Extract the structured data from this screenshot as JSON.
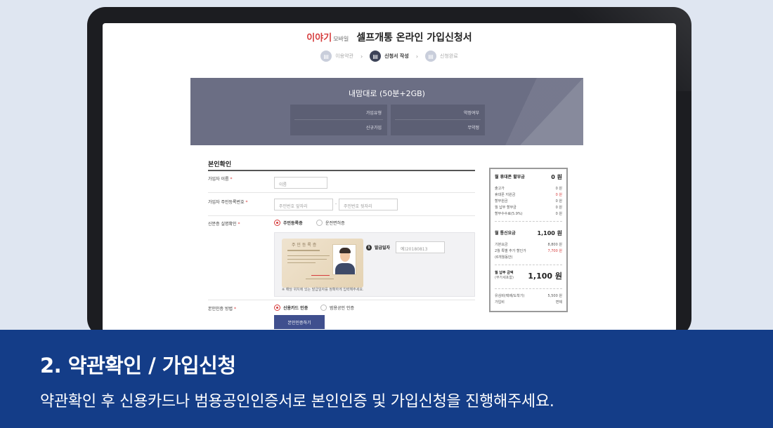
{
  "header": {
    "brand": "이야기",
    "brand_sub": "모바일",
    "title": "셀프개통 온라인 가입신청서"
  },
  "steps": [
    {
      "label": "이용약관"
    },
    {
      "label": "신청서 작성"
    },
    {
      "label": "신청완료"
    }
  ],
  "plan": {
    "name": "내맘대로 (50분+2GB)",
    "box1": {
      "row1": "가입유형",
      "row2": "신규가입"
    },
    "box2": {
      "row1": "약정여부",
      "row2": "무약정"
    }
  },
  "form": {
    "section_title": "본인확인",
    "name_label": "가입자 이름",
    "name_placeholder": "이름",
    "rrn_label": "가입자 주민등록번호",
    "rrn_front_placeholder": "주민번호 앞자리",
    "rrn_back_placeholder": "주민번호 뒷자리",
    "rrn_dash": "-",
    "idcheck_label": "신분증 실명확인",
    "idcheck_opt1": "주민등록증",
    "idcheck_opt2": "운전면허증",
    "req_mark": "*",
    "issue_num": "1",
    "issue_label": "발급일자",
    "issue_placeholder": "예)20180813",
    "id_note": "※ 해당 위치에 있는 발급일자를 정확하게 입력해주세요.",
    "idcard_title": "주 민 등 록 증",
    "auth_label": "본인인증 방법",
    "auth_opt1": "신용카드 인증",
    "auth_opt2": "범용공인 인증",
    "auth_button": "본인인증하기"
  },
  "summary": {
    "device_label": "월 휴대폰 할부금",
    "device_value": "0 원",
    "device_items": [
      {
        "label": "출고가",
        "value": "0 원"
      },
      {
        "label": "휴대폰 지원금",
        "value": "0 원"
      },
      {
        "label": "할부원금",
        "value": "0 원"
      },
      {
        "label": "월 납부 할부금",
        "value": "0 원"
      },
      {
        "label": "할부수수료(5.9%)",
        "value": "0 원"
      }
    ],
    "plan_label": "월 통신요금",
    "plan_value": "1,100 원",
    "plan_items": [
      {
        "label": "기본요금",
        "value": "8,800 원"
      },
      {
        "label": "2월 특별 추가 할인가",
        "value": "7,700 원"
      },
      {
        "label": "(6개월동안)",
        "value": ""
      }
    ],
    "total_label": "월 납부 금액",
    "total_sub": "(부가세포함)",
    "total_value": "1,100 원",
    "extra_items": [
      {
        "label": "유심비(택배/도착기)",
        "value": "5,500 원"
      },
      {
        "label": "가입비",
        "value": "면제"
      }
    ]
  },
  "banner": {
    "title": "2. 약관확인 / 가입신청",
    "desc": "약관확인 후 신용카드나 범용공인인증서로 본인인증 및 가입신청을 진행해주세요."
  },
  "colors": {
    "banner": "#143d88",
    "accent_red": "#d63c3c",
    "plan_bg": "#6b6e84",
    "button": "#3f4f8e"
  }
}
